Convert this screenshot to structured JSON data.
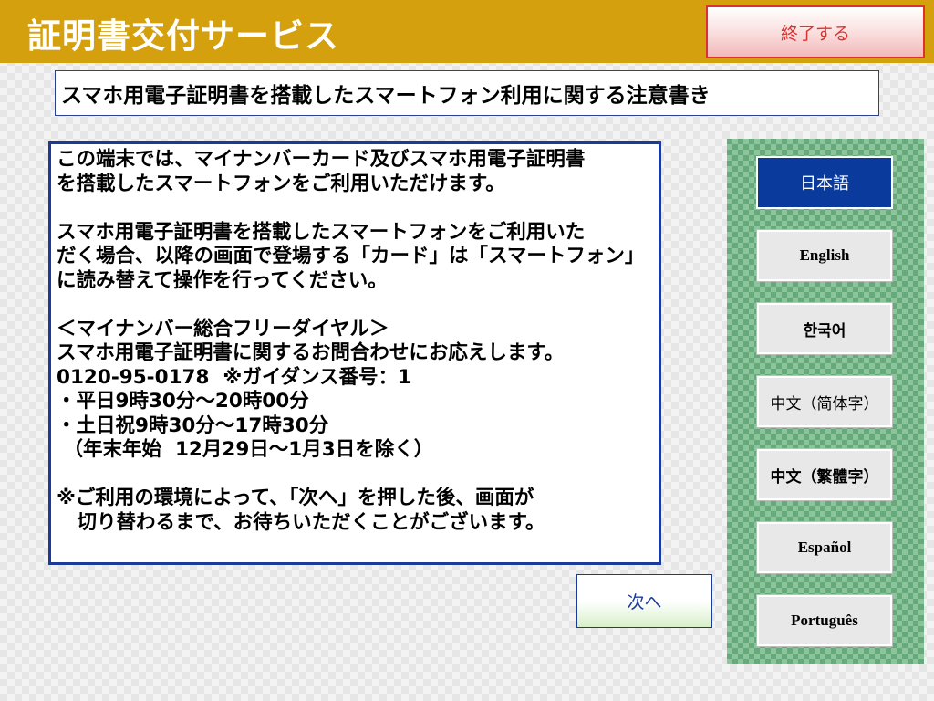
{
  "header": {
    "title": "証明書交付サービス",
    "exit_label": "終了する"
  },
  "notice_title": "スマホ用電子証明書を搭載したスマートフォン利用に関する注意書き",
  "content_lines": [
    "この端末では、マイナンバーカード及びスマホ用電子証明書",
    "を搭載したスマートフォンをご利用いただけます。",
    "",
    "スマホ用電子証明書を搭載したスマートフォンをご利用いた",
    "だく場合、以降の画面で登場する「カード」は「スマートフォン」",
    "に読み替えて操作を行ってください。",
    "",
    "＜マイナンバー総合フリーダイヤル＞",
    "スマホ用電子証明書に関するお問合わせにお応えします。",
    "0120-95-0178  ※ガイダンス番号：1",
    "・平日9時30分～20時00分",
    "・土日祝9時30分～17時30分",
    " （年末年始  12月29日～1月3日を除く）",
    "",
    "※ご利用の環境によって、「次へ」を押した後、画面が",
    "   切り替わるまで、お待ちいただくことがございます。"
  ],
  "next_label": "次へ",
  "languages": [
    {
      "label": "日本語",
      "selected": true
    },
    {
      "label": "English",
      "selected": false
    },
    {
      "label": "한국어",
      "selected": false
    },
    {
      "label": "中文（简体字）",
      "selected": false
    },
    {
      "label": "中文（繁體字）",
      "selected": false
    },
    {
      "label": "Español",
      "selected": false
    },
    {
      "label": "Português",
      "selected": false
    }
  ],
  "colors": {
    "header_bg": "#d4a00e",
    "exit_border": "#d9322f",
    "accent_blue": "#0a3b9c",
    "lang_panel_green": "#66a97a"
  }
}
